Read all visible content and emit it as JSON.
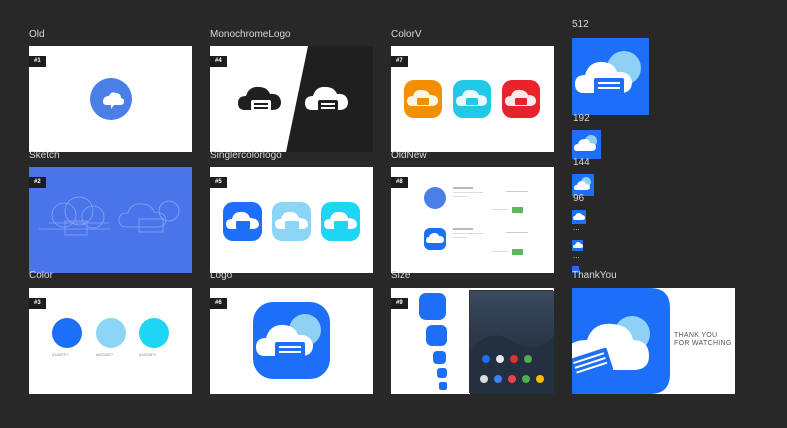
{
  "artboards": [
    {
      "name": "Old",
      "badge": "#1"
    },
    {
      "name": "MonochromeLogo",
      "badge": "#4"
    },
    {
      "name": "ColorV",
      "badge": "#7"
    },
    {
      "name": "Sketch",
      "badge": "#2"
    },
    {
      "name": "Singlercolorlogo",
      "badge": "#5"
    },
    {
      "name": "OldNew",
      "badge": "#8"
    },
    {
      "name": "Color",
      "badge": "#3"
    },
    {
      "name": "Logo",
      "badge": "#6"
    },
    {
      "name": "Size",
      "badge": "#9"
    },
    {
      "name": "ThankYou",
      "badge": ""
    }
  ],
  "sizes": {
    "s512": "512",
    "s192": "192",
    "s144": "144",
    "s96": "96",
    "dots1": "...",
    "dots2": "...",
    "thank_line1": "THANK YOU",
    "thank_line2": "FOR WATCHING"
  },
  "swatches": [
    {
      "hex": "#1E6FF7",
      "label": "#1E6FF7"
    },
    {
      "hex": "#8CD5F7",
      "label": "#8CD5F7"
    },
    {
      "hex": "#1ED5F4",
      "label": "#1ED5F4"
    }
  ],
  "colors": {
    "brand_blue": "#1e6ff7",
    "canvas_bg": "#282828",
    "orange": "#f39000",
    "cyan": "#20c9e8",
    "red": "#e8232c"
  }
}
